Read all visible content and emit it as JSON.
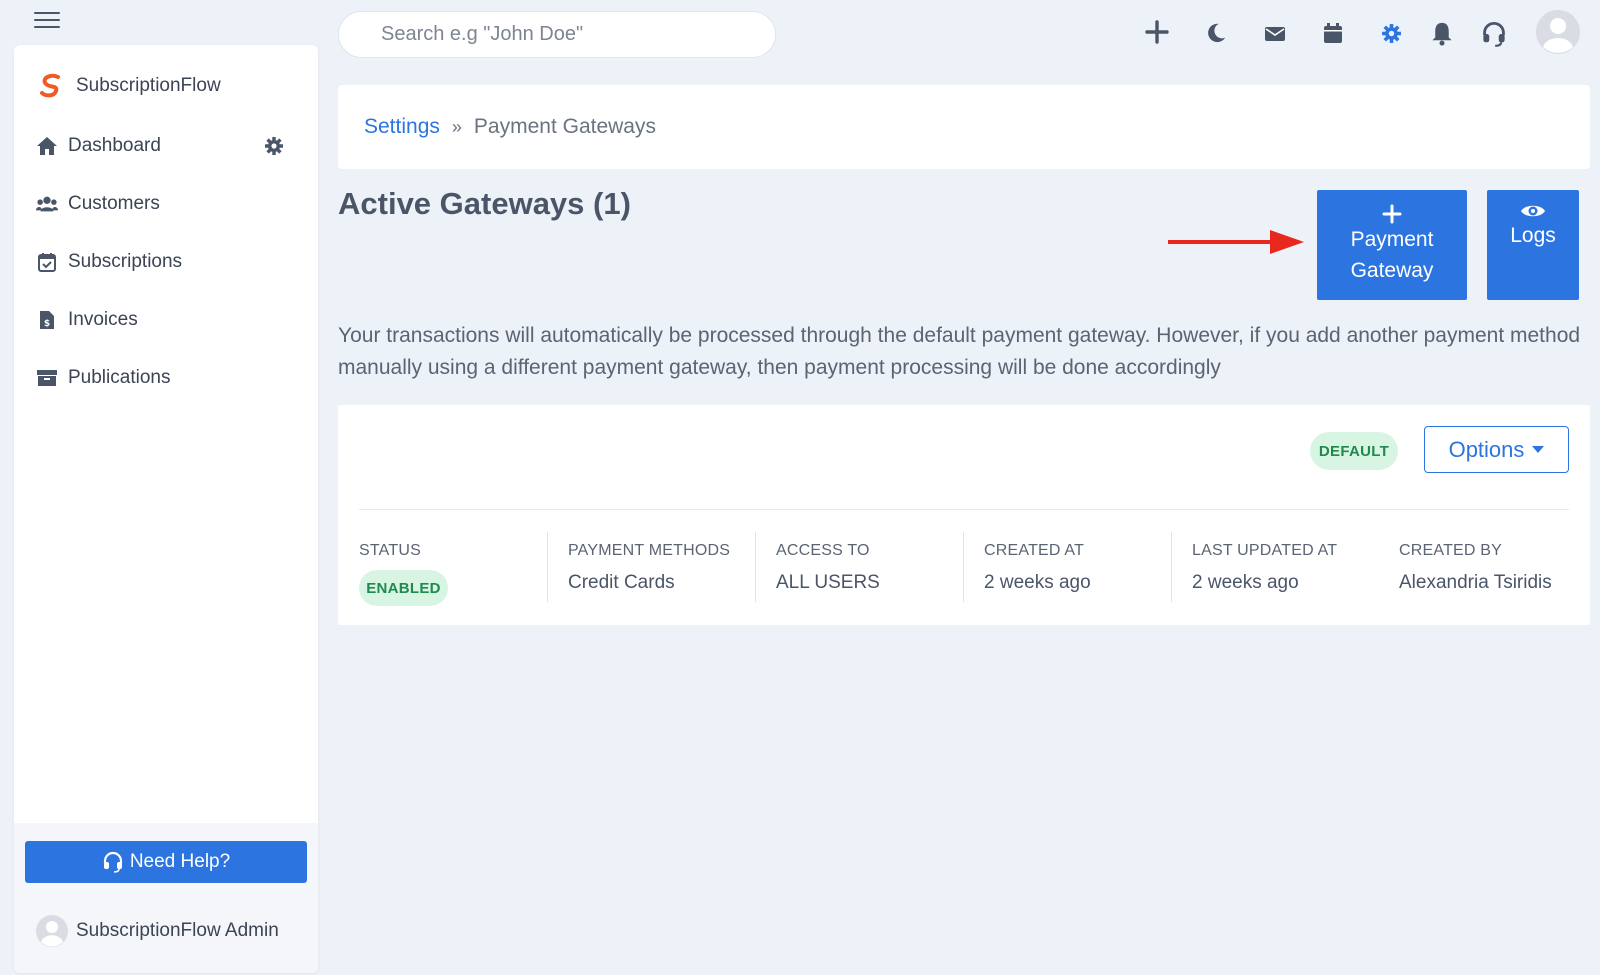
{
  "app": {
    "name": "SubscriptionFlow"
  },
  "sidebar": {
    "items": [
      {
        "label": "Dashboard",
        "icon": "home-icon"
      },
      {
        "label": "Customers",
        "icon": "users-icon"
      },
      {
        "label": "Subscriptions",
        "icon": "calendar-check-icon"
      },
      {
        "label": "Invoices",
        "icon": "invoice-icon"
      },
      {
        "label": "Publications",
        "icon": "archive-icon"
      }
    ],
    "help_label": "Need Help?",
    "user_name": "SubscriptionFlow Admin"
  },
  "search": {
    "placeholder": "Search e.g \"John Doe\""
  },
  "topbar": {
    "icons": [
      "plus-icon",
      "moon-icon",
      "envelope-icon",
      "calendar-icon",
      "gear-icon",
      "bell-icon",
      "headset-icon",
      "avatar"
    ]
  },
  "breadcrumb": {
    "parent": "Settings",
    "separator": "»",
    "current": "Payment Gateways"
  },
  "page": {
    "title": "Active Gateways (1)",
    "add_button": {
      "line1": "Payment",
      "line2": "Gateway"
    },
    "logs_button": "Logs",
    "description": "Your transactions will automatically be processed through the default payment gateway. However, if you add another payment method manually using a different payment gateway, then payment processing will be done accordingly"
  },
  "gateway": {
    "default_badge": "DEFAULT",
    "options_label": "Options",
    "columns": [
      {
        "head": "STATUS",
        "value": "ENABLED"
      },
      {
        "head": "PAYMENT METHODS",
        "value": "Credit Cards"
      },
      {
        "head": "ACCESS TO",
        "value": "ALL USERS"
      },
      {
        "head": "CREATED AT",
        "value": "2 weeks ago"
      },
      {
        "head": "LAST UPDATED AT",
        "value": "2 weeks ago"
      },
      {
        "head": "CREATED BY",
        "value": "Alexandria Tsiridis"
      }
    ]
  },
  "colors": {
    "accent": "#2c74e0",
    "background": "#edf1f8",
    "badge_bg": "#d8f5e4",
    "badge_text": "#1f8a4c",
    "arrow": "#e8281c",
    "brand_orange": "#f15a24"
  }
}
